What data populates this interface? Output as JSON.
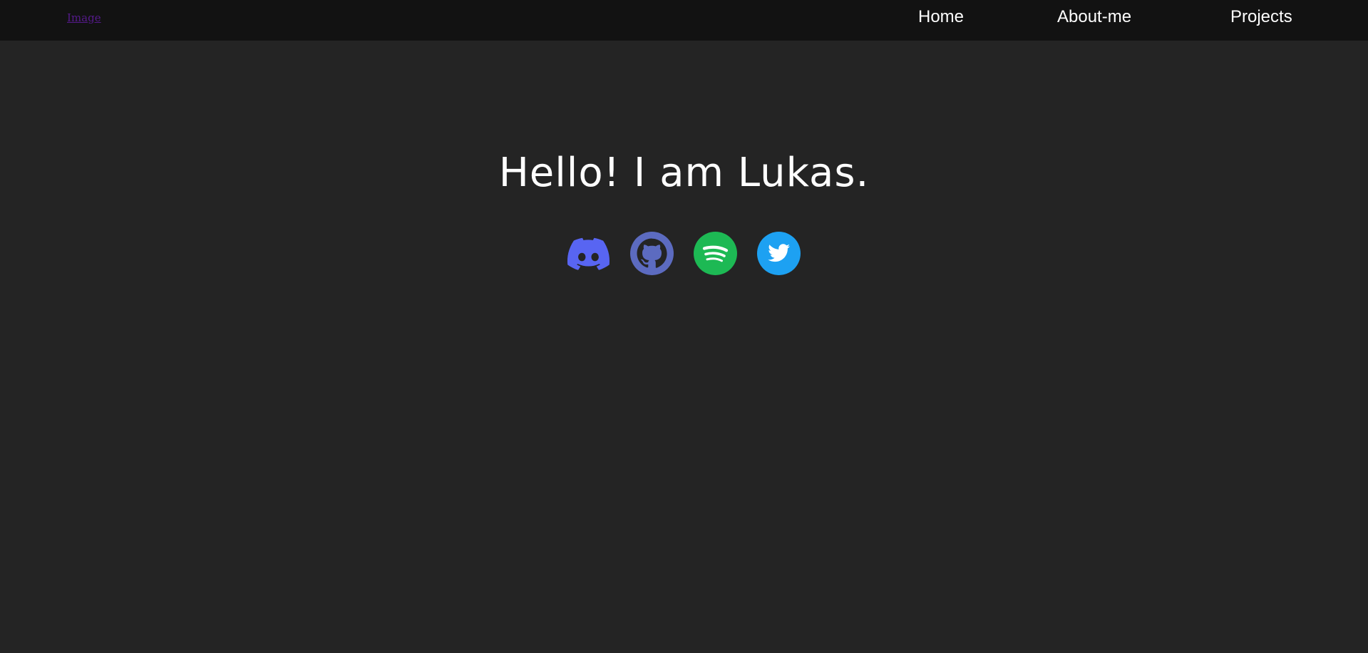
{
  "navbar": {
    "logo_text": "Image",
    "links": [
      {
        "label": "Home"
      },
      {
        "label": "About-me"
      },
      {
        "label": "Projects"
      }
    ]
  },
  "hero": {
    "title": "Hello! I am Lukas."
  },
  "socials": [
    {
      "icon": "discord-icon",
      "color": "#5865F2"
    },
    {
      "icon": "github-icon",
      "color": "#5C6BC0"
    },
    {
      "icon": "spotify-icon",
      "color": "#1DB954"
    },
    {
      "icon": "twitter-icon",
      "color": "#1DA1F2"
    }
  ],
  "colors": {
    "background": "#242424",
    "navbar": "#121212",
    "text": "#ffffff",
    "visited_link": "#551a8b"
  }
}
